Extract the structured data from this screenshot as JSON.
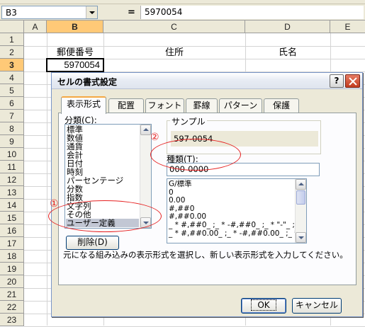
{
  "formula_bar": {
    "name_box": "B3",
    "equals": "=",
    "content": "5970054"
  },
  "sheet": {
    "columns": [
      "A",
      "B",
      "C",
      "D",
      "E"
    ],
    "rows": [
      "1",
      "2",
      "3",
      "4",
      "5",
      "6",
      "7",
      "8",
      "9",
      "10",
      "11",
      "12",
      "13",
      "14",
      "15",
      "16",
      "17",
      "18",
      "19",
      "20",
      "21",
      "22",
      "23"
    ],
    "selected_cell": "B3",
    "cells": {
      "b2": "郵便番号",
      "c2": "住所",
      "d2": "氏名",
      "b3": "5970054"
    }
  },
  "dialog": {
    "title": "セルの書式設定",
    "help": "?",
    "tabs": [
      "表示形式",
      "配置",
      "フォント",
      "罫線",
      "パターン",
      "保護"
    ],
    "active_tab": "表示形式",
    "category_label": "分類(C):",
    "categories": [
      "標準",
      "数値",
      "通貨",
      "会計",
      "日付",
      "時刻",
      "パーセンテージ",
      "分数",
      "指数",
      "文字列",
      "その他",
      "ユーザー定義"
    ],
    "selected_category": "ユーザー定義",
    "sample_label": "サンプル",
    "sample_value": "597-0054",
    "type_label": "種類(T):",
    "type_value": "000-0000",
    "formats": [
      "G/標準",
      "0",
      "0.00",
      "#,##0",
      "#,##0.00",
      "_ * #,##0_ ;_ * -#,##0_ ;_ * \"-\"_ ;_ @_",
      "_ * #,##0.00_ ;_ * -#,##0.00_ ;_ * \"-\"??_ ;_ @_"
    ],
    "delete_button": "削除(D)",
    "description": "元になる組み込みの表示形式を選択し、新しい表示形式を入力してください。",
    "ok_button": "OK",
    "cancel_button": "キャンセル",
    "annotations": {
      "one": "①",
      "two": "②"
    }
  },
  "colors": {
    "annotation": "#e62020",
    "header_selected": "#ffc977",
    "dialog_bg": "#ece9d8"
  }
}
